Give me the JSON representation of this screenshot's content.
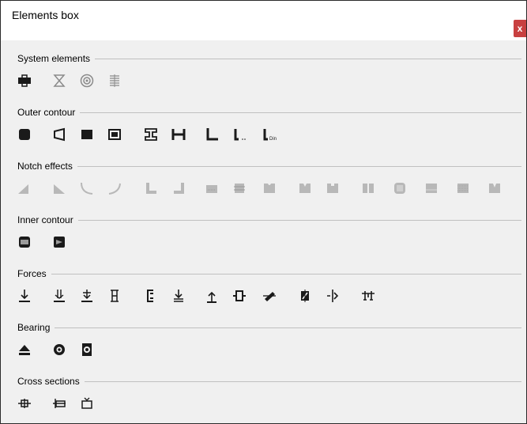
{
  "window": {
    "title": "Elements box",
    "close_label": "x"
  },
  "groups": [
    {
      "label": "System elements",
      "icons": [
        "coupling-icon",
        "hourglass-icon",
        "target-icon",
        "spring-icon"
      ]
    },
    {
      "label": "Outer contour",
      "icons": [
        "cylinder-icon",
        "cone-icon",
        "square-icon",
        "hollow-square-icon",
        "i-beam-icon",
        "h-beam-icon",
        "l-profile-icon",
        "l-profile-small-icon",
        "l-profile-din-icon"
      ]
    },
    {
      "label": "Notch effects",
      "icons": [
        "chamfer-left-icon",
        "chamfer-right-icon",
        "fillet-left-icon",
        "fillet-right-icon",
        "step-left-icon",
        "step-right-icon",
        "groove-flat-icon",
        "groove-round-icon",
        "notch-u-icon",
        "notch-v-icon",
        "notch-square-icon",
        "cross-bore-icon",
        "rounded-rect-icon",
        "rect-notch-icon",
        "knurl-icon",
        "wedge-notch-icon"
      ]
    },
    {
      "label": "Inner contour",
      "icons": [
        "inner-bore-icon",
        "inner-cone-icon"
      ]
    },
    {
      "label": "Forces",
      "icons": [
        "force-down-icon",
        "force-down-double-icon",
        "force-down-bar-icon",
        "force-axial-icon",
        "bracket-force-icon",
        "force-down-ground-icon",
        "force-up-icon",
        "torque-box-icon",
        "torque-diagonal-icon",
        "torque-block-icon",
        "moment-arrow-icon",
        "support-frame-icon"
      ]
    },
    {
      "label": "Bearing",
      "icons": [
        "eject-bearing-icon",
        "ball-bearing-icon",
        "roller-bearing-icon"
      ]
    },
    {
      "label": "Cross sections",
      "icons": [
        "cross-section-icon",
        "cross-section-bar-icon",
        "cross-section-top-icon"
      ]
    }
  ]
}
